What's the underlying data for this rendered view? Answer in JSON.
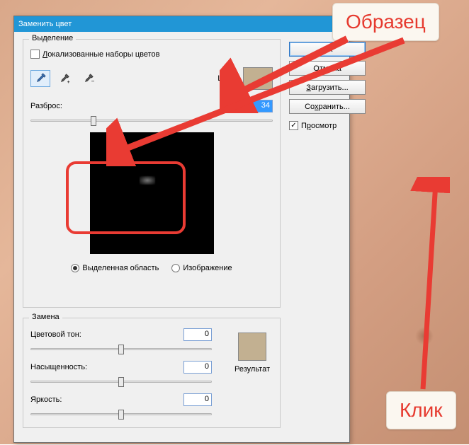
{
  "dialog": {
    "title": "Заменить цвет",
    "selection": {
      "legend": "Выделение",
      "localized_label": "Локализованные наборы цветов",
      "localized_checked": false,
      "color_label": "Цвет:",
      "swatch_color": "#c2b091",
      "fuzziness_label": "Разброс:",
      "fuzziness_value": "34",
      "fuzziness_pos_pct": 26,
      "radio_selection": "Выделенная область",
      "radio_image": "Изображение",
      "radio_selected": "selection"
    },
    "replace": {
      "legend": "Замена",
      "hue_label": "Цветовой тон:",
      "hue_value": "0",
      "hue_pos_pct": 50,
      "sat_label": "Насыщенность:",
      "sat_value": "0",
      "sat_pos_pct": 50,
      "light_label": "Яркость:",
      "light_value": "0",
      "light_pos_pct": 50,
      "result_label": "Результат",
      "result_color": "#c2b091"
    },
    "buttons": {
      "ok": "ОК",
      "cancel": "Отмена",
      "load": "Загрузить...",
      "save": "Сохранить...",
      "preview_label": "Просмотр",
      "preview_checked": true
    }
  },
  "annotations": {
    "sample": "Образец",
    "click": "Клик"
  }
}
